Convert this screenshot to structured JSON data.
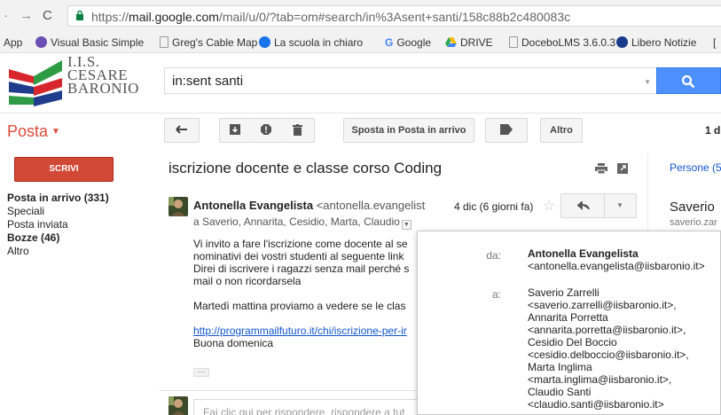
{
  "browser": {
    "url_prefix": "https://",
    "url_host": "mail.google.com",
    "url_path": "/mail/u/0/?tab=om#search/in%3Asent+santi/158c88b2c480083c",
    "bookmarks": [
      {
        "label": "App",
        "color": "#4285f4"
      },
      {
        "label": "Visual Basic Simple",
        "color": "#6b4fb3"
      },
      {
        "label": "Greg's Cable Map",
        "color": "#ffffff"
      },
      {
        "label": "La scuola in chiaro",
        "color": "#1a73e8"
      },
      {
        "label": "Google",
        "color": "#ea4335"
      },
      {
        "label": "DRIVE",
        "color": "#34a853"
      },
      {
        "label": "DoceboLMS 3.6.0.3",
        "color": "#ffffff"
      },
      {
        "label": "Libero Notizie",
        "color": "#1a3a8a"
      },
      {
        "label": "[",
        "color": "#ffffff"
      }
    ]
  },
  "logo": {
    "line1": "I.I.S.",
    "line2": "CESARE",
    "line3": "BARONIO"
  },
  "search": {
    "value": "in:sent santi"
  },
  "toolbar": {
    "app_name": "Posta",
    "move_inbox_label": "Sposta in Posta in arrivo",
    "more_label": "Altro",
    "pager": "1 d"
  },
  "sidebar": {
    "compose_label": "SCRIVI",
    "items": [
      {
        "label": "Posta in arrivo (331)",
        "bold": true
      },
      {
        "label": "Speciali",
        "bold": false
      },
      {
        "label": "Posta inviata",
        "bold": false
      },
      {
        "label": "Bozze (46)",
        "bold": true
      },
      {
        "label": "Altro",
        "bold": false
      }
    ]
  },
  "message": {
    "subject": "iscrizione docente e classe corso Coding",
    "sender_name": "Antonella Evangelista",
    "sender_email_partial": "<antonella.evangelista(",
    "recipients_line": "a Saverio, Annarita, Cesidio, Marta, Claudio",
    "date": "4 dic (6 giorni fa)",
    "body_lines": [
      "Vi invito a fare l'iscrizione come docente al se",
      "nominativi dei vostri studenti  al seguente link",
      "Direi di iscrivere i ragazzi senza mail perché s",
      "mail o non ricordarsela",
      "",
      "Martedì mattina proviamo a vedere se le clas",
      "",
      "http://programmailfuturo.it/chi/iscrizione-per-ir",
      "Buona domenica"
    ],
    "reply_placeholder": "Fai clic qui per rispondere, rispondere a tut"
  },
  "people_panel": {
    "title": "Persone (5",
    "name": "Saverio",
    "email": "saverio.zar"
  },
  "details_popup": {
    "from_label": "da:",
    "from_name": "Antonella Evangelista",
    "from_email": "<antonella.evangelista@iisbaronio.it>",
    "to_label": "a:",
    "to_lines": [
      "Saverio Zarrelli",
      "<saverio.zarrelli@iisbaronio.it>,",
      "Annarita Porretta",
      "<annarita.porretta@iisbaronio.it>,",
      "Cesidio Del Boccio",
      "<cesidio.delboccio@iisbaronio.it>,",
      "Marta Inglima",
      "<marta.inglima@iisbaronio.it>,",
      "Claudio Santi",
      "<claudio.santi@iisbaronio.it>"
    ]
  }
}
